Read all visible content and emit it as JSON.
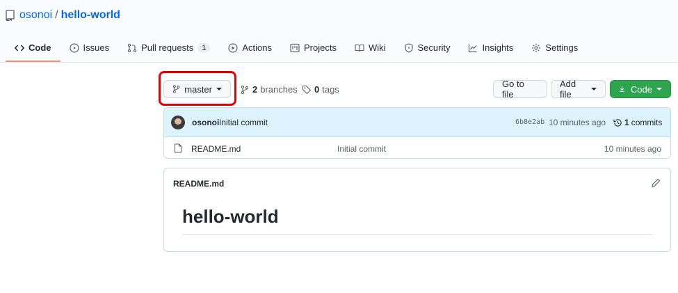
{
  "repo": {
    "owner": "osonoi",
    "separator": "/",
    "name": "hello-world"
  },
  "tabs": [
    {
      "label": "Code",
      "icon": "code-icon",
      "active": true
    },
    {
      "label": "Issues",
      "icon": "issue-icon"
    },
    {
      "label": "Pull requests",
      "icon": "pull-request-icon",
      "count": "1"
    },
    {
      "label": "Actions",
      "icon": "play-icon"
    },
    {
      "label": "Projects",
      "icon": "project-icon"
    },
    {
      "label": "Wiki",
      "icon": "book-icon"
    },
    {
      "label": "Security",
      "icon": "shield-icon"
    },
    {
      "label": "Insights",
      "icon": "graph-icon"
    },
    {
      "label": "Settings",
      "icon": "gear-icon"
    }
  ],
  "branch_bar": {
    "branch": "master",
    "branches_count": "2",
    "branches_label": "branches",
    "tags_count": "0",
    "tags_label": "tags",
    "go_to_file": "Go to file",
    "add_file": "Add file",
    "code": "Code"
  },
  "commit": {
    "author": "osonoi",
    "message": "Initial commit",
    "hash": "6b8e2ab",
    "time": "10 minutes ago",
    "count": "1",
    "count_label": "commits"
  },
  "files": [
    {
      "name": "README.md",
      "message": "Initial commit",
      "time": "10 minutes ago"
    }
  ],
  "readme": {
    "title": "README.md",
    "heading": "hello-world"
  },
  "colors": {
    "accent": "#0969da",
    "green": "#2da44e",
    "highlight": "#e00000",
    "tab_underline": "#fd8c73"
  }
}
